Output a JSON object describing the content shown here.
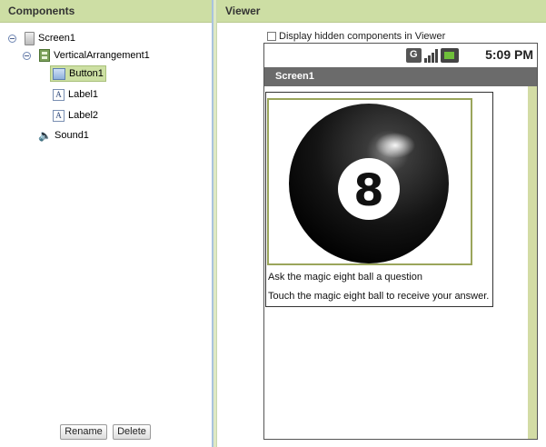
{
  "components_panel": {
    "title": "Components",
    "tree": [
      {
        "label": "Screen1",
        "icon": "screen-icon"
      },
      {
        "label": "VerticalArrangement1",
        "icon": "vertical-arrangement-icon"
      },
      {
        "label": "Button1",
        "icon": "button-icon",
        "selected": true
      },
      {
        "label": "Label1",
        "icon": "label-icon"
      },
      {
        "label": "Label2",
        "icon": "label-icon"
      },
      {
        "label": "Sound1",
        "icon": "sound-icon"
      }
    ],
    "rename_label": "Rename",
    "delete_label": "Delete"
  },
  "viewer_panel": {
    "title": "Viewer",
    "hidden_components_label": "Display hidden components in Viewer",
    "status_time": "5:09 PM",
    "screen_title": "Screen1",
    "ball_number": "8",
    "label1": "Ask the magic eight ball a question",
    "label2": "Touch the magic eight ball to receive your answer."
  },
  "colors": {
    "header_bg": "#cddea4",
    "selection_bg": "#cde0a3",
    "title_bar_bg": "#6b6b6b",
    "scrollbar_bg": "#d3dca5"
  }
}
